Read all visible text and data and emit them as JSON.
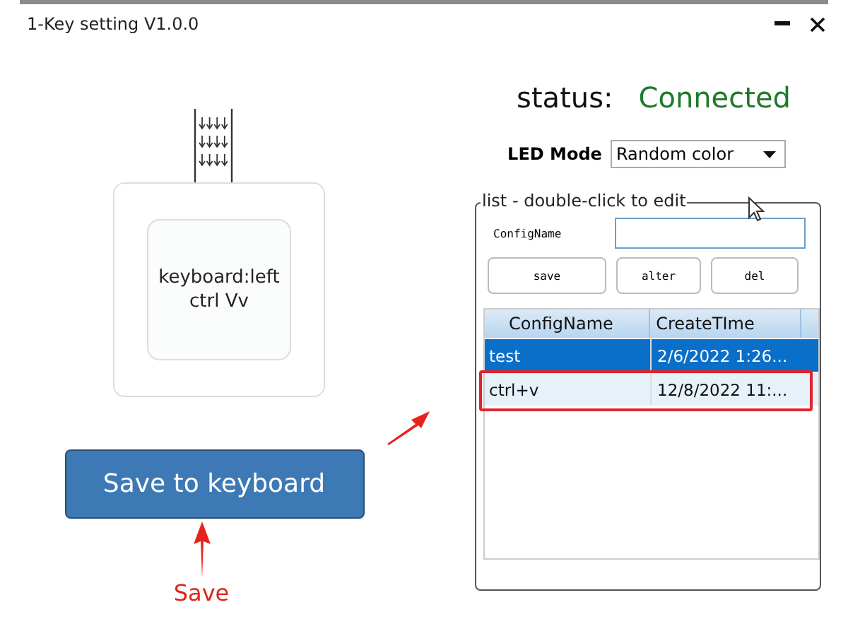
{
  "window": {
    "title": "1-Key setting V1.0.0"
  },
  "status": {
    "label": "status:",
    "value": "Connected"
  },
  "led_mode": {
    "label": "LED Mode",
    "value": "Random color"
  },
  "device": {
    "key_label": "keyboard:left ctrl Vv"
  },
  "save_button": {
    "label": "Save to keyboard"
  },
  "list": {
    "title": "list - double-click to edit",
    "name_label": "ConfigName",
    "buttons": [
      "save",
      "alter",
      "del"
    ],
    "columns": [
      "ConfigName",
      "CreateTIme"
    ],
    "rows": [
      {
        "cells": [
          "test",
          "2/6/2022 1:26..."
        ],
        "selected": true,
        "annotated": false
      },
      {
        "cells": [
          "ctrl+v",
          "12/8/2022 11:..."
        ],
        "selected": false,
        "annotated": true
      }
    ]
  },
  "annotation": {
    "label": "Save"
  }
}
